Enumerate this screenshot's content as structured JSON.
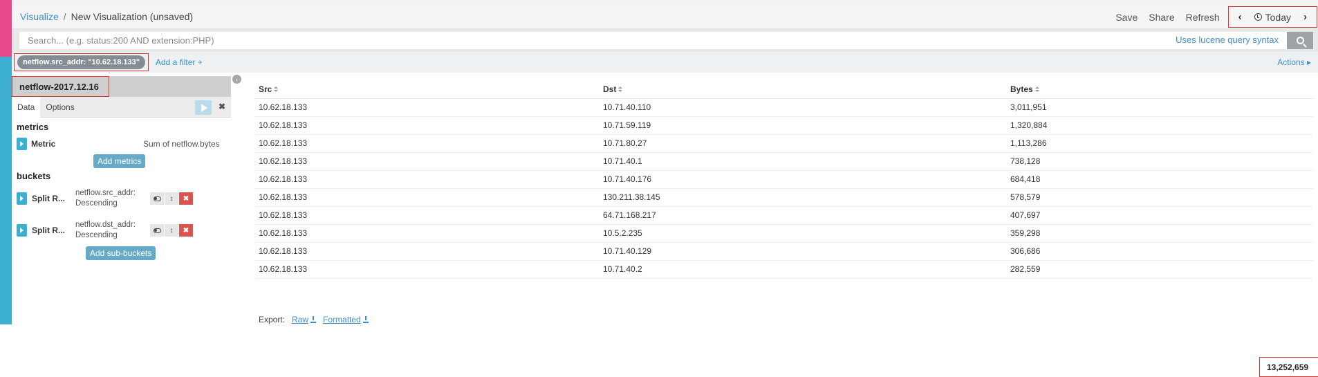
{
  "header": {
    "breadcrumb_link": "Visualize",
    "breadcrumb_sep": "/",
    "title": "New Visualization (unsaved)",
    "save_label": "Save",
    "share_label": "Share",
    "refresh_label": "Refresh",
    "prev_icon": "chevron-left-icon",
    "next_icon": "chevron-right-icon",
    "time_label": "Today"
  },
  "search": {
    "placeholder": "Search... (e.g. status:200 AND extension:PHP)",
    "lucene_label": "Uses lucene query syntax"
  },
  "filters": {
    "active_filter": "netflow.src_addr: \"10.62.18.133\"",
    "add_filter_label": "Add a filter",
    "add_filter_icon": "+",
    "actions_label": "Actions",
    "actions_icon": "▸"
  },
  "sidebar": {
    "index_name": "netflow-2017.12.16",
    "collapse_icon": "‹",
    "tabs": [
      "Data",
      "Options"
    ],
    "metrics_title": "metrics",
    "metric": {
      "name": "Metric",
      "description": "Sum of netflow.bytes"
    },
    "add_metrics_label": "Add metrics",
    "buckets_title": "buckets",
    "buckets": [
      {
        "name": "Split R...",
        "field": "netflow.src_addr:",
        "order": "Descending"
      },
      {
        "name": "Split R...",
        "field": "netflow.dst_addr:",
        "order": "Descending"
      }
    ],
    "add_sub_buckets_label": "Add sub-buckets",
    "ctl_reorder": "↕",
    "ctl_remove": "✖",
    "close_label": "✖"
  },
  "table": {
    "columns": [
      "Src",
      "Dst",
      "Bytes"
    ],
    "rows": [
      [
        "10.62.18.133",
        "10.71.40.110",
        "3,011,951"
      ],
      [
        "10.62.18.133",
        "10.71.59.119",
        "1,320,884"
      ],
      [
        "10.62.18.133",
        "10.71.80.27",
        "1,113,286"
      ],
      [
        "10.62.18.133",
        "10.71.40.1",
        "738,128"
      ],
      [
        "10.62.18.133",
        "10.71.40.176",
        "684,418"
      ],
      [
        "10.62.18.133",
        "130.211.38.145",
        "578,579"
      ],
      [
        "10.62.18.133",
        "64.71.168.217",
        "407,697"
      ],
      [
        "10.62.18.133",
        "10.5.2.235",
        "359,298"
      ],
      [
        "10.62.18.133",
        "10.71.40.129",
        "306,686"
      ],
      [
        "10.62.18.133",
        "10.71.40.2",
        "282,559"
      ]
    ],
    "total": "13,252,659"
  },
  "export": {
    "label": "Export:",
    "raw_label": "Raw",
    "formatted_label": "Formatted"
  },
  "colors": {
    "accent_pink": "#e8488b",
    "accent_blue": "#3caed2",
    "link": "#3f8fc4",
    "highlight_red": "#d9342b"
  }
}
